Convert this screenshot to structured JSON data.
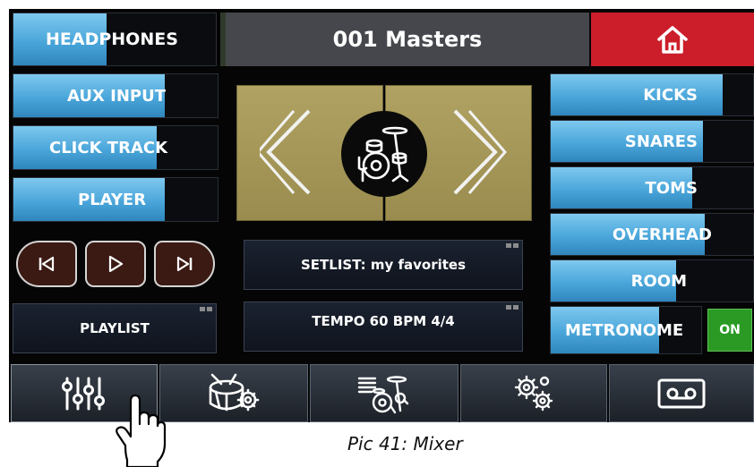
{
  "header": {
    "source_label": "HEADPHONES",
    "source_level": 0.46,
    "kit_name": "001 Masters",
    "home_icon": "home-icon",
    "home_color": "#cc1e2a"
  },
  "left_faders": [
    {
      "label": "AUX INPUT",
      "level": 0.74
    },
    {
      "label": "CLICK TRACK",
      "level": 0.7
    },
    {
      "label": "PLAYER",
      "level": 0.74
    }
  ],
  "transport": {
    "prev_icon": "skip-previous-icon",
    "play_icon": "play-icon",
    "next_icon": "skip-next-icon"
  },
  "kit_selector": {
    "prev_icon": "chevron-left-icon",
    "kit_icon": "drum-kit-icon",
    "next_icon": "chevron-right-icon",
    "color": "#a89a5c"
  },
  "info": {
    "playlist": "PLAYLIST",
    "setlist": "SETLIST: my favorites",
    "tempo": "TEMPO 60 BPM 4/4"
  },
  "right_faders": [
    {
      "label": "KICKS",
      "level": 0.85
    },
    {
      "label": "SNARES",
      "level": 0.75
    },
    {
      "label": "TOMS",
      "level": 0.7
    },
    {
      "label": "OVERHEAD",
      "level": 0.76
    },
    {
      "label": "ROOM",
      "level": 0.62
    }
  ],
  "metronome": {
    "label": "METRONOME",
    "level": 0.72,
    "toggle": "ON",
    "toggle_color": "#2b9a24"
  },
  "nav_tabs": [
    {
      "name": "mixer",
      "icon": "sliders-icon"
    },
    {
      "name": "drum-settings",
      "icon": "drum-gear-icon"
    },
    {
      "name": "kit-settings",
      "icon": "drumkit-gear-icon"
    },
    {
      "name": "settings",
      "icon": "gears-icon"
    },
    {
      "name": "recorder",
      "icon": "cassette-icon"
    }
  ],
  "caption": "Pic 41: Mixer"
}
